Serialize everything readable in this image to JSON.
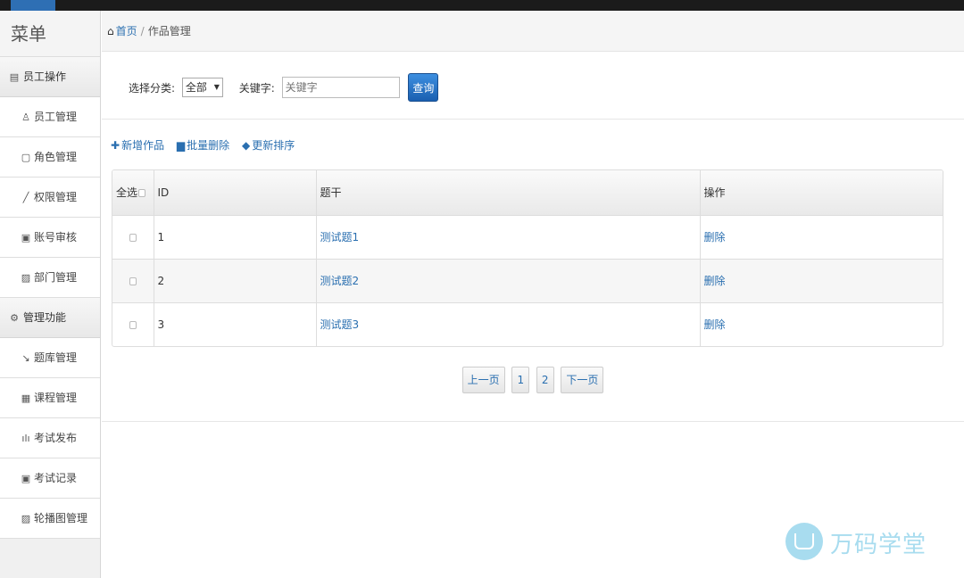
{
  "sidebar": {
    "title": "菜单",
    "groups": [
      {
        "label": "员工操作",
        "items": [
          "员工管理",
          "角色管理",
          "权限管理",
          "账号审核",
          "部门管理"
        ]
      },
      {
        "label": "管理功能",
        "items": [
          "题库管理",
          "课程管理",
          "考试发布",
          "考试记录",
          "轮播图管理"
        ]
      }
    ]
  },
  "breadcrumb": {
    "home": "首页",
    "separator": "/",
    "current": "作品管理"
  },
  "search": {
    "category_label": "选择分类:",
    "category_value": "全部",
    "keyword_label": "关键字:",
    "keyword_placeholder": "关键字",
    "query_button": "查询"
  },
  "toolbar": {
    "add": "新增作品",
    "batch_delete": "批量删除",
    "update_sort": "更新排序"
  },
  "table": {
    "headers": {
      "select_all": "全选",
      "id": "ID",
      "title": "题干",
      "action": "操作"
    },
    "rows": [
      {
        "id": "1",
        "title": "测试题1",
        "action": "删除"
      },
      {
        "id": "2",
        "title": "测试题2",
        "action": "删除"
      },
      {
        "id": "3",
        "title": "测试题3",
        "action": "删除"
      }
    ]
  },
  "pagination": {
    "prev": "上一页",
    "pages": [
      "1",
      "2"
    ],
    "next": "下一页"
  },
  "watermark": {
    "text": "万码学堂"
  },
  "colors": {
    "link": "#2a6fb0",
    "topbar": "#1b1b1b",
    "query_button": "#2368b9",
    "watermark": "#a8dcef"
  }
}
